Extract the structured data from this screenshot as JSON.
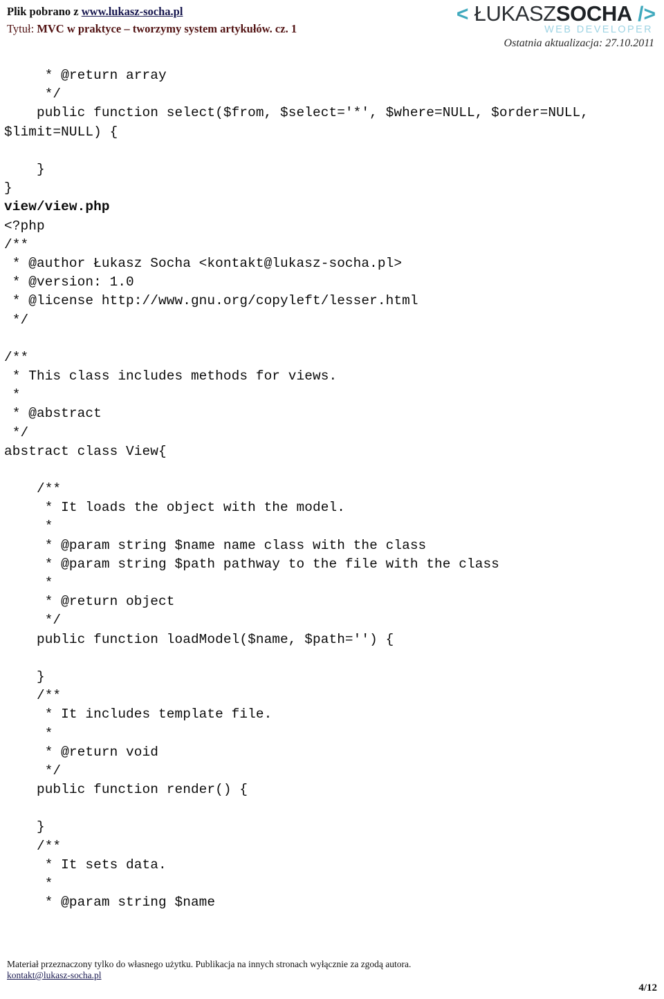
{
  "header": {
    "downloaded_from_label": "Plik pobrano z ",
    "site_link": "www.lukasz-socha.pl",
    "title_label": "Tytuł: ",
    "title_value": "MVC w praktyce – tworzymy system artykułów. cz. 1",
    "logo": {
      "open_angle": "<",
      "name_first": " ŁUKASZ",
      "name_second": "SOCHA",
      "close_angle": " />",
      "subtitle": "WEB DEVELOPER"
    },
    "last_update": "Ostatnia aktualizacja: 27.10.2011"
  },
  "content": {
    "blocks": [
      {
        "id": "db-select-tail",
        "bold": false,
        "text": "     * @return array\n     */\n    public function select($from, $select='*', $where=NULL, $order=NULL, $limit=NULL) {\n\n    }\n}"
      },
      {
        "id": "view-file-heading",
        "bold": true,
        "text": "view/view.php"
      },
      {
        "id": "view-header-docblock",
        "bold": false,
        "text": "<?php\n/**\n * @author Łukasz Socha <kontakt@lukasz-socha.pl>\n * @version: 1.0\n * @license http://www.gnu.org/copyleft/lesser.html\n */"
      },
      {
        "id": "view-class-docblock",
        "bold": false,
        "text": "/**\n * This class includes methods for views.\n *\n * @abstract\n */\nabstract class View{"
      },
      {
        "id": "loadmodel-block",
        "bold": false,
        "text": "    /**\n     * It loads the object with the model.\n     *\n     * @param string $name name class with the class\n     * @param string $path pathway to the file with the class\n     *\n     * @return object\n     */\n    public function loadModel($name, $path='') {"
      },
      {
        "id": "render-block",
        "bold": false,
        "text": "    }\n    /**\n     * It includes template file.\n     *\n     * @return void\n     */\n    public function render() {"
      },
      {
        "id": "setdata-block",
        "bold": false,
        "text": "    }\n    /**\n     * It sets data.\n     *\n     * @param string $name"
      }
    ]
  },
  "footer": {
    "note": "Materiał przeznaczony tylko do własnego użytku. Publikacja na innych stronach wyłącznie za zgodą autora.",
    "email": "kontakt@lukasz-socha.pl",
    "page_number": "4/12"
  }
}
